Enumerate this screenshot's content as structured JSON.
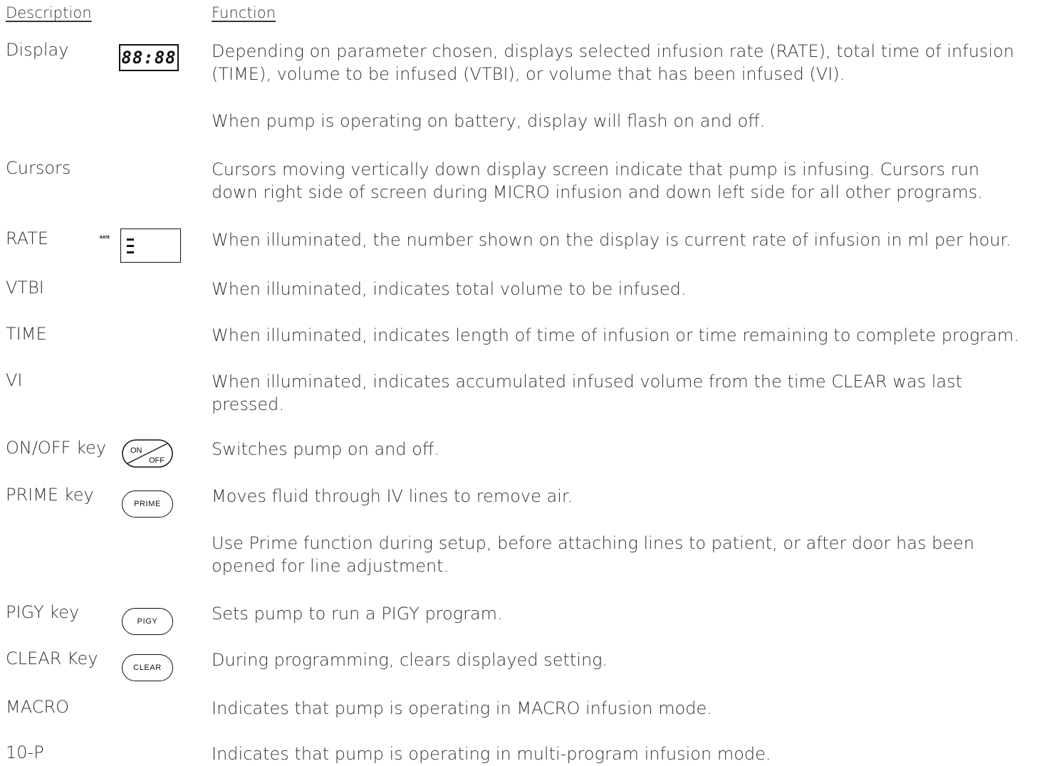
{
  "headers": {
    "description": "Description",
    "function": "Function"
  },
  "rows": [
    {
      "label": "Display",
      "icon": "seven-segment-display-icon",
      "icon_text": "88:88",
      "function": [
        "Depending on parameter chosen, displays selected infusion rate (RATE), total time of infusion (TIME), volume to be infused (VTBI), or volume that has been infused (VI).",
        "When pump is operating on battery, display will flash on and off."
      ]
    },
    {
      "label": "Cursors",
      "function": [
        "Cursors moving vertically down display screen indicate that pump is infusing. Cursors run down right side of screen during MICRO infusion and down left side for all other programs."
      ]
    },
    {
      "label": "RATE",
      "icon": "rate-indicator-icon",
      "icon_text": "RATE",
      "function": [
        "When illuminated, the number shown on the display is current rate of infusion in ml per hour."
      ]
    },
    {
      "label": "VTBI",
      "function": [
        "When illuminated, indicates total volume to be infused."
      ]
    },
    {
      "label": "TIME",
      "function": [
        "When illuminated, indicates length of time of infusion or time remaining to complete program."
      ]
    },
    {
      "label": "VI",
      "function": [
        "When illuminated, indicates accumulated infused volume from the time CLEAR was last pressed."
      ]
    },
    {
      "label": "ON/OFF key",
      "icon": "on-off-key-icon",
      "icon_text_top": "ON",
      "icon_text_bottom": "OFF",
      "function": [
        "Switches pump on and off."
      ]
    },
    {
      "label": "PRIME key",
      "icon": "prime-key-icon",
      "icon_text": "PRIME",
      "function": [
        "Moves fluid through IV lines to remove air.",
        "Use Prime function during setup, before attaching lines to patient, or after door has been opened for line adjustment."
      ]
    },
    {
      "label": "PIGY key",
      "icon": "pigy-key-icon",
      "icon_text": "PIGY",
      "function": [
        "Sets pump to run a PIGY program."
      ]
    },
    {
      "label": "CLEAR Key",
      "icon": "clear-key-icon",
      "icon_text": "CLEAR",
      "function": [
        "During programming, clears displayed setting."
      ]
    },
    {
      "label": "MACRO",
      "function": [
        "Indicates that pump is operating in MACRO infusion mode."
      ]
    },
    {
      "label": "10-P",
      "function": [
        "Indicates that pump is operating in multi-program infusion mode."
      ]
    }
  ]
}
